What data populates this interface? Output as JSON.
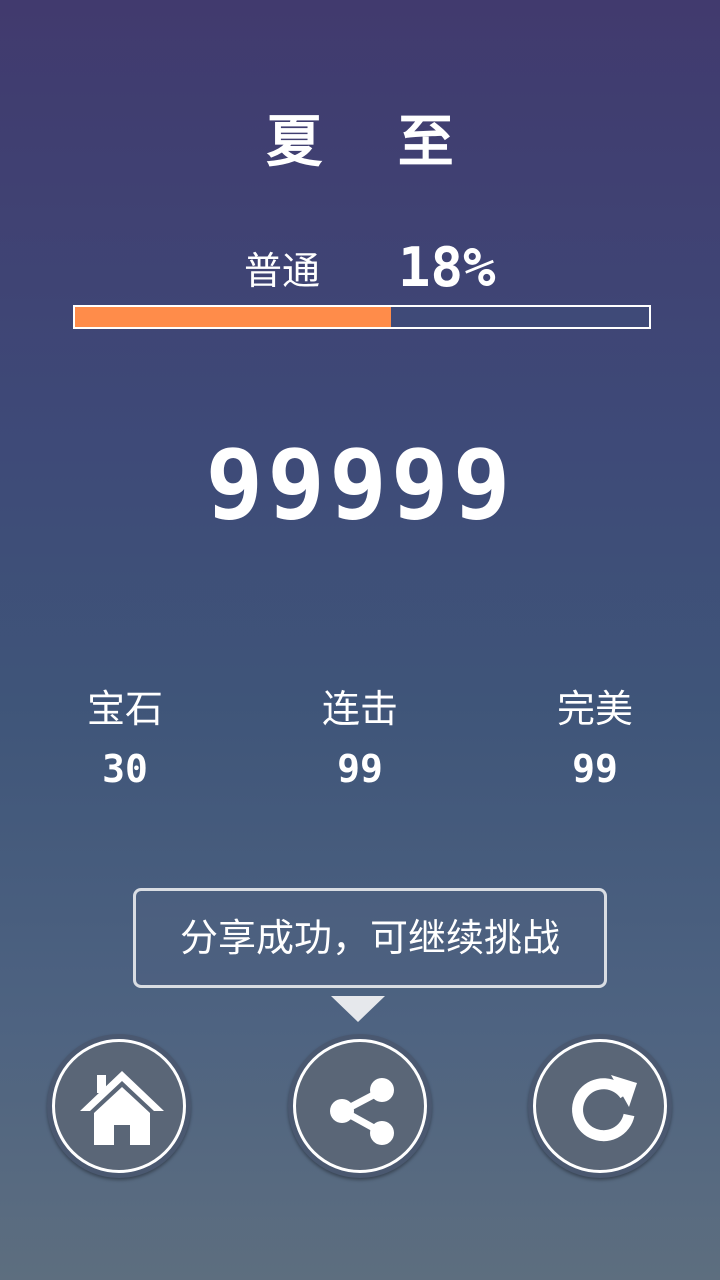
{
  "song": {
    "title": "夏 至"
  },
  "difficulty": {
    "label": "普通",
    "percent_text": "18%",
    "progress_fraction": 0.55,
    "fill_color": "#ff8c4a"
  },
  "score": {
    "value": "99999"
  },
  "stats": {
    "gems": {
      "label": "宝石",
      "value": "30"
    },
    "combo": {
      "label": "连击",
      "value": "99"
    },
    "perfect": {
      "label": "完美",
      "value": "99"
    }
  },
  "tooltip": {
    "text": "分享成功，可继续挑战"
  },
  "buttons": {
    "home": {
      "icon": "home-icon"
    },
    "share": {
      "icon": "share-icon"
    },
    "retry": {
      "icon": "refresh-icon"
    }
  }
}
